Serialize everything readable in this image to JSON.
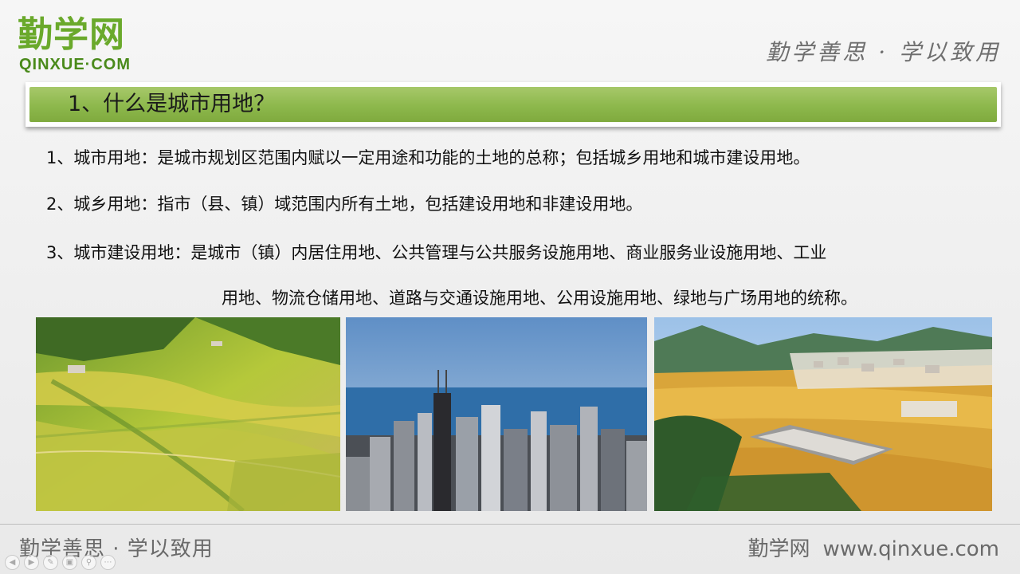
{
  "header": {
    "logo_cn": "勤学网",
    "logo_en": "QINXUE·COM",
    "motto": "勤学善思 · 学以致用"
  },
  "title": "1、什么是城市用地？",
  "definitions": [
    {
      "num": "1、",
      "term": "城市用地：",
      "body": "是城市规划区范围内赋以一定用途和功能的土地的总称；包括城乡用地和城市建设用地。"
    },
    {
      "num": "2、",
      "term": "城乡用地：",
      "body": "指市（县、镇）域范围内所有土地，包括建设用地和非建设用地。"
    },
    {
      "num": "3、",
      "term": "城市建设用地：",
      "body": "是城市（镇）内居住用地、公共管理与公共服务设施用地、商业服务业设施用地、工业",
      "continuation": "用地、物流仓储用地、道路与交通设施用地、公用设施用地、绿地与广场用地的统称。"
    }
  ],
  "footer": {
    "motto": "勤学善思 · 学以致用",
    "site_name": "勤学网",
    "site_url": "www.qinxue.com"
  },
  "colors": {
    "brand_green": "#6aa92b",
    "title_bar": "#8db84c"
  },
  "controls": [
    "prev-icon",
    "next-icon",
    "pen-icon",
    "slides-icon",
    "zoom-icon",
    "menu-icon"
  ]
}
